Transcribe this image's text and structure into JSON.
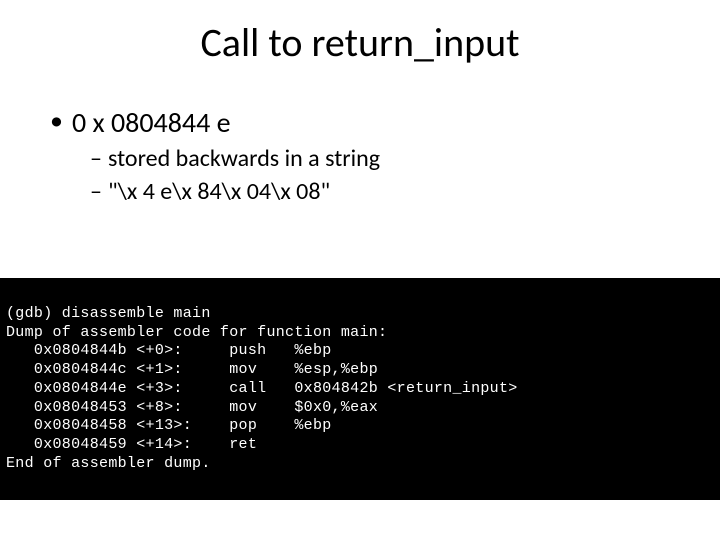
{
  "title": "Call to return_input",
  "bullets": {
    "l1_0": "0 x 0804844 e",
    "l2_0": "stored backwards in a string",
    "l2_1": "\"\\x 4 e\\x 84\\x 04\\x 08\""
  },
  "terminal": {
    "line0": "(gdb) disassemble main",
    "line1": "Dump of assembler code for function main:",
    "line2": "   0x0804844b <+0>:     push   %ebp",
    "line3": "   0x0804844c <+1>:     mov    %esp,%ebp",
    "line4": "   0x0804844e <+3>:     call   0x804842b <return_input>",
    "line5": "   0x08048453 <+8>:     mov    $0x0,%eax",
    "line6": "   0x08048458 <+13>:    pop    %ebp",
    "line7": "   0x08048459 <+14>:    ret    ",
    "line8": "End of assembler dump."
  }
}
